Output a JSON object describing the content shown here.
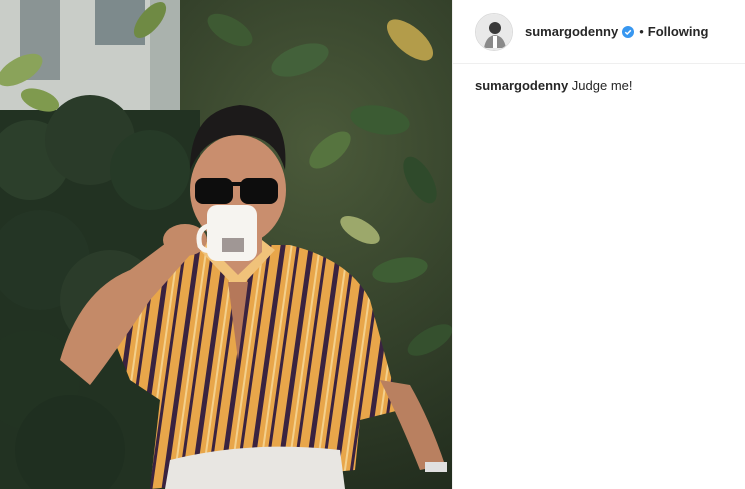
{
  "post": {
    "photo_alt": "Photo",
    "header": {
      "username": "sumargodenny",
      "separator": "•",
      "follow_status": "Following"
    },
    "caption": {
      "username": "sumargodenny",
      "text": " Judge me!"
    },
    "icons": {
      "verified": "verified-badge-icon",
      "avatar": "avatar"
    },
    "colors": {
      "verified_blue": "#3897f0",
      "text": "#262626",
      "divider": "#efefef"
    }
  }
}
